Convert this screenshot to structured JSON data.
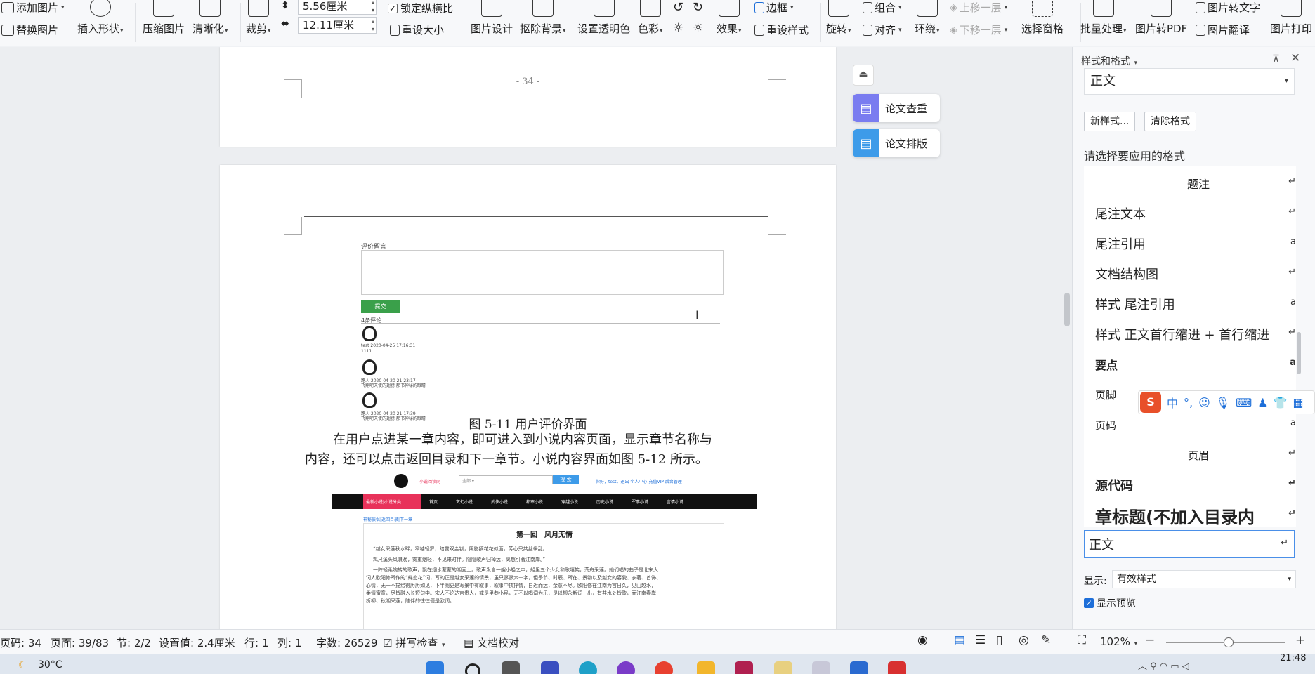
{
  "ribbon": {
    "add_picture": "添加图片",
    "replace_picture": "替换图片",
    "insert_shape": "插入形状",
    "compress_picture": "压缩图片",
    "clarify": "清晰化",
    "crop": "裁剪",
    "height_value": "5.56厘米",
    "width_value": "12.11厘米",
    "lock_ratio": "锁定纵横比",
    "reset_size": "重设大小",
    "picture_design": "图片设计",
    "remove_background": "抠除背景",
    "set_transparent": "设置透明色",
    "color": "色彩",
    "effects": "效果",
    "border": "边框",
    "reset_style": "重设样式",
    "rotate": "旋转",
    "group": "组合",
    "align": "对齐",
    "wrap": "环绕",
    "bring_forward": "上移一层",
    "send_backward": "下移一层",
    "selection_pane": "选择窗格",
    "batch_process": "批量处理",
    "pic_to_pdf": "图片转PDF",
    "pic_to_text": "图片转文字",
    "pic_translate": "图片翻译",
    "pic_print": "图片打印"
  },
  "document": {
    "page_number": "- 34 -",
    "shot1": {
      "label_comment": "评价留言",
      "submit": "提交",
      "count": "4条评论",
      "c1_meta": "test 2020-04-25 17:16:31",
      "c1_text": "1111",
      "c2_meta": "路人 2020-04-20 21:23:17",
      "c2_text": "飞翔吧天使的翅膀 那书神秘的眼睛",
      "c3_meta": "路人 2020-04-20 21:17:39",
      "c3_text": "飞翔吧天使的翅膀 那书神秘的眼睛"
    },
    "caption": "图 5-11 用户评价界面",
    "para_line1": "在用户点进某一章内容，即可进入到小说内容页面，显示章节名称与",
    "para_line2": "内容，还可以点击返回目录和下一章节。小说内容界面如图 5-12 所示。",
    "shot2": {
      "site_name": "小说阅读网",
      "search_select": "全部 ▾",
      "search_btn": "搜 索",
      "user_links": "你好，test，退出  个人中心  充值VIP  后台管理",
      "nav": [
        "最新小说|小说分类",
        "首页",
        "玄幻小说",
        "武侠小说",
        "都市小说",
        "穿越小说",
        "历史小说",
        "军事小说",
        "言情小说"
      ],
      "crumb": "神秘侠侣|返回目录|下一章",
      "chapter_title": "第一回　风月无情",
      "line1": "“越女采莲秋水畔，窄袖轻罗，暗露双金钏，照影摘花花似面，芳心只共丝争乱。",
      "line2": "鸡尺溪头风浪晚，雾重烟轻，不见来时伴。隐隐歌声归棹远，离愁引著江南岸。”",
      "line3": "一阵轻柔婉转的歌声，飘在烟水蒙蒙的湖面上。歌声发自一艘小船之中，船里五个少女和歌嘻笑，荡舟采莲。她们唱的曲子是北宋大",
      "line4": "词人欧阳修所作的“蝶恋花”词，写的正是越女采莲的情景，虽只寥寥六十字，但季节、时辰、所在、景物以及越女的容貌、衣著、首饰、",
      "line5": "心情，无一不描绘得历历如见，下半阕更是写景中有叙事，叙事中挟抒情，自近而远，余意不尽。欧阳修在江南为官日久，见山越水，",
      "line6": "柔情蜜意，尽皆融入长短句中。宋人不论达官贵人，或是里巷小民，无不以唱词为乐，是以柳永新词一出，有井水处皆歌，而江南春岸",
      "line7": "折柳、秋湖采莲，随伴的往往便是欧词。"
    }
  },
  "float": {
    "paper_check": "论文查重",
    "paper_format": "论文排版"
  },
  "panel": {
    "title": "样式和格式",
    "current_style": "正文",
    "new_style": "新样式...",
    "clear_format": "清除格式",
    "choose_label": "请选择要应用的格式",
    "styles": [
      {
        "name": "题注",
        "mark": "↵"
      },
      {
        "name": " 尾注文本",
        "mark": "↵"
      },
      {
        "name": "尾注引用",
        "mark": "a"
      },
      {
        "name": "文档结构图",
        "mark": "↵"
      },
      {
        "name": "样式 尾注引用",
        "mark": "a"
      },
      {
        "name": "样式 正文首行缩进 + 首行缩进",
        "mark": "↵"
      },
      {
        "name": "要点",
        "mark": "a"
      },
      {
        "name": "页脚",
        "mark": "↵"
      },
      {
        "name": "页码",
        "mark": "a"
      },
      {
        "name": "页眉",
        "mark": "↵"
      },
      {
        "name": "源代码",
        "mark": "↵"
      },
      {
        "name": "章标题(不加入目录内",
        "mark": "↵"
      },
      {
        "name": "正文",
        "mark": "↵"
      }
    ],
    "show_label": "显示:",
    "show_value": "有效样式",
    "show_preview": "显示预览"
  },
  "ime": {
    "cn": "中",
    "punct": "°,"
  },
  "status": {
    "page": "页码: 34",
    "pages": "页面: 39/83",
    "section": "节: 2/2",
    "setting": "设置值: 2.4厘米",
    "row": "行: 1",
    "col": "列: 1",
    "words": "字数: 26529",
    "spell": "拼写检查",
    "proof": "文档校对",
    "zoom": "102%"
  },
  "taskbar": {
    "weather": "30°C",
    "time": "21:48"
  },
  "colors": {
    "accent_blue": "#1e6fd9",
    "submit_green": "#3aa04a",
    "nav_black": "#111111",
    "nav_pink": "#e8325a",
    "float_purple": "#7a7cf0",
    "float_blue": "#3d9be9"
  }
}
